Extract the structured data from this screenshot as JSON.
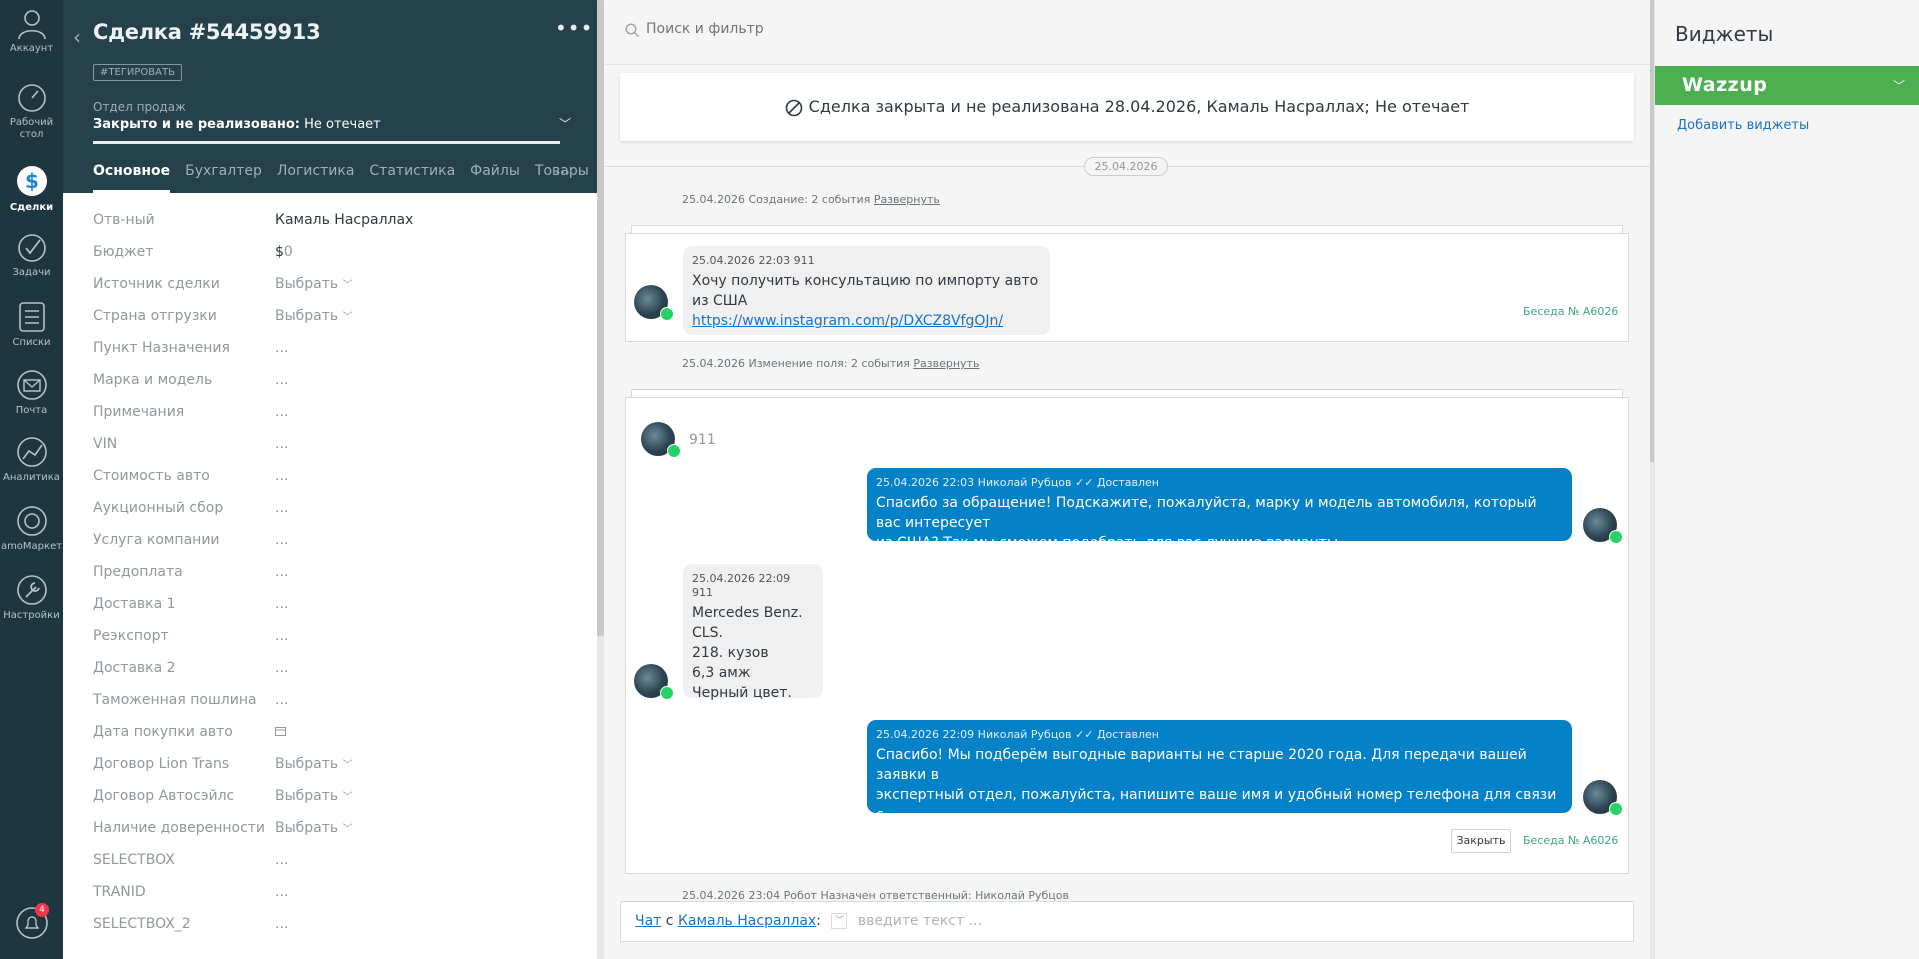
{
  "nav": {
    "items": [
      {
        "label": "Аккаунт",
        "icon": "account-icon"
      },
      {
        "label": "Рабочий стол",
        "icon": "dashboard-icon"
      },
      {
        "label": "Сделки",
        "icon": "deals-icon",
        "active": true
      },
      {
        "label": "Задачи",
        "icon": "tasks-icon"
      },
      {
        "label": "Списки",
        "icon": "lists-icon"
      },
      {
        "label": "Почта",
        "icon": "mail-icon"
      },
      {
        "label": "Аналитика",
        "icon": "analytics-icon"
      },
      {
        "label": "amoМаркет",
        "icon": "market-icon"
      },
      {
        "label": "Настройки",
        "icon": "settings-icon"
      }
    ],
    "notifications_count": "4"
  },
  "card": {
    "title": "Сделка #54459913",
    "tag_button": "#ТЕГИРОВАТЬ",
    "pipeline": "Отдел продаж",
    "status_bold": "Закрыто и не реализовано:",
    "status_reason": "Не отечает",
    "tabs": [
      "Основное",
      "Бухгалтер",
      "Логистика",
      "Статистика",
      "Файлы",
      "Товары"
    ],
    "fields": [
      {
        "label": "Отв-ный",
        "value": "Камаль Насраллах"
      },
      {
        "label": "Бюджет",
        "value": "$",
        "value_muted": "0"
      },
      {
        "label": "Источник сделки",
        "value": "Выбрать"
      },
      {
        "label": "Страна отгрузки",
        "value": "Выбрать"
      },
      {
        "label": "Пункт Назначения",
        "value": "..."
      },
      {
        "label": "Марка и модель",
        "value": "..."
      },
      {
        "label": "Примечания",
        "value": "..."
      },
      {
        "label": "VIN",
        "value": "..."
      },
      {
        "label": "Стоимость авто",
        "value": "..."
      },
      {
        "label": "Аукционный сбор",
        "value": "..."
      },
      {
        "label": "Услуга компании",
        "value": "..."
      },
      {
        "label": "Предоплата",
        "value": "..."
      },
      {
        "label": "Доставка 1",
        "value": "..."
      },
      {
        "label": "Реэкспорт",
        "value": "..."
      },
      {
        "label": "Доставка 2",
        "value": "..."
      },
      {
        "label": "Таможенная пошлина",
        "value": "..."
      },
      {
        "label": "Дата покупки авто",
        "value": ""
      },
      {
        "label": "Договор Lion Trans",
        "value": "Выбрать"
      },
      {
        "label": "Договор Автосэйлс",
        "value": "Выбрать"
      },
      {
        "label": "Наличие доверенности",
        "value": "Выбрать"
      },
      {
        "label": "SELECTBOX",
        "value": "..."
      },
      {
        "label": "TRANID",
        "value": "..."
      },
      {
        "label": "SELECTBOX_2",
        "value": "..."
      }
    ]
  },
  "feed": {
    "search_placeholder": "Поиск и фильтр",
    "closed_banner": "Сделка закрыта и не реализована 28.04.2026, Камаль Насраллах; Не отечает",
    "date_separator": "25.04.2026",
    "event1": {
      "text": "25.04.2026 Создание: 2 события",
      "link": "Развернуть"
    },
    "event2": {
      "text": "25.04.2026 Изменение поля: 2 события",
      "link": "Развернуть"
    },
    "event3": {
      "text": "25.04.2026 23:04 Робот Назначен ответственный: Николай Рубцов"
    },
    "message1": {
      "meta": "25.04.2026 22:03 911",
      "text": "Хочу получить консультацию по импорту авто из США",
      "link": "https://www.instagram.com/p/DXCZ8VfgOJn/"
    },
    "conversation_label": "Беседа № A6026",
    "contact_name": "911",
    "message2": {
      "meta_time": "25.04.2026 22:03 Николай Рубцов",
      "meta_status": "Доставлен",
      "line1": "Спасибо за обращение! Подскажите, пожалуйста, марку и модель автомобиля, который вас интересует",
      "line2": "из США? Так мы сможем подобрать для вас лучшие варианты."
    },
    "message3": {
      "meta": "25.04.2026 22:09 911",
      "lines": [
        "Mercedes Benz.",
        "CLS.",
        "218. кузов",
        "6,3 амж",
        "Черный цвет."
      ]
    },
    "message4": {
      "meta_time": "25.04.2026 22:09 Николай Рубцов",
      "meta_status": "Доставлен",
      "line1": "Спасибо! Мы подберём выгодные варианты не старше 2020 года. Для передачи вашей заявки в",
      "line2": "экспертный отдел, пожалуйста, напишите ваше имя и удобный номер телефона для связи с",
      "line3": "менеджером."
    },
    "close_button": "Закрыть",
    "chat_bar": {
      "chat_link": "Чат",
      "with": "с",
      "contact_link": "Камаль Насраллах",
      "colon": ":",
      "placeholder": "введите текст ..."
    }
  },
  "widgets": {
    "title": "Виджеты",
    "wazzup_name": "Wazzup",
    "add_link": "Добавить виджеты"
  },
  "colors": {
    "nav_bg": "#1e3640",
    "card_header_bg": "#25414b",
    "outgoing_bubble": "#0582c7",
    "wazzup_green": "#4caf50",
    "whatsapp_green": "#25d366",
    "link_blue": "#1a73c7"
  }
}
